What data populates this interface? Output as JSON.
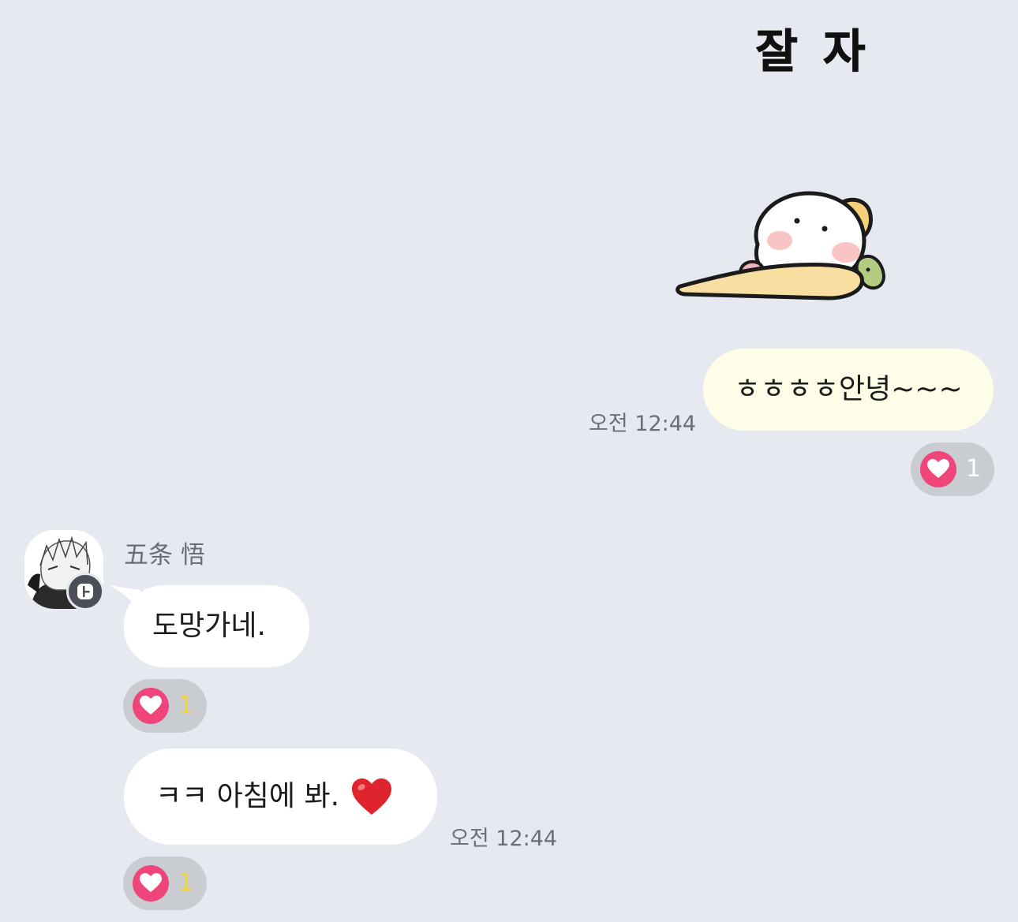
{
  "sticker": {
    "caption": "잘 자",
    "icon": "sleeping-bunny-sticker"
  },
  "messages": {
    "outgoing_text": "ㅎㅎㅎㅎ안녕~~~",
    "outgoing_time": "오전 12:44",
    "sender_name": "五条 悟",
    "incoming_1_text": "도망가네.",
    "incoming_2_text": "ㅋㅋ 아침에 봐.",
    "incoming_2_time": "오전 12:44"
  },
  "reactions": {
    "r1_count": "1",
    "r2_count": "1",
    "r3_count": "1",
    "icon": "heart-icon"
  },
  "colors": {
    "background": "#e6eaf0",
    "outgoing_bubble": "#fefee8",
    "incoming_bubble": "#ffffff",
    "reaction_pill": "#c9cdd2",
    "heart": "#f0457a",
    "count_yellow": "#f4d23c"
  }
}
